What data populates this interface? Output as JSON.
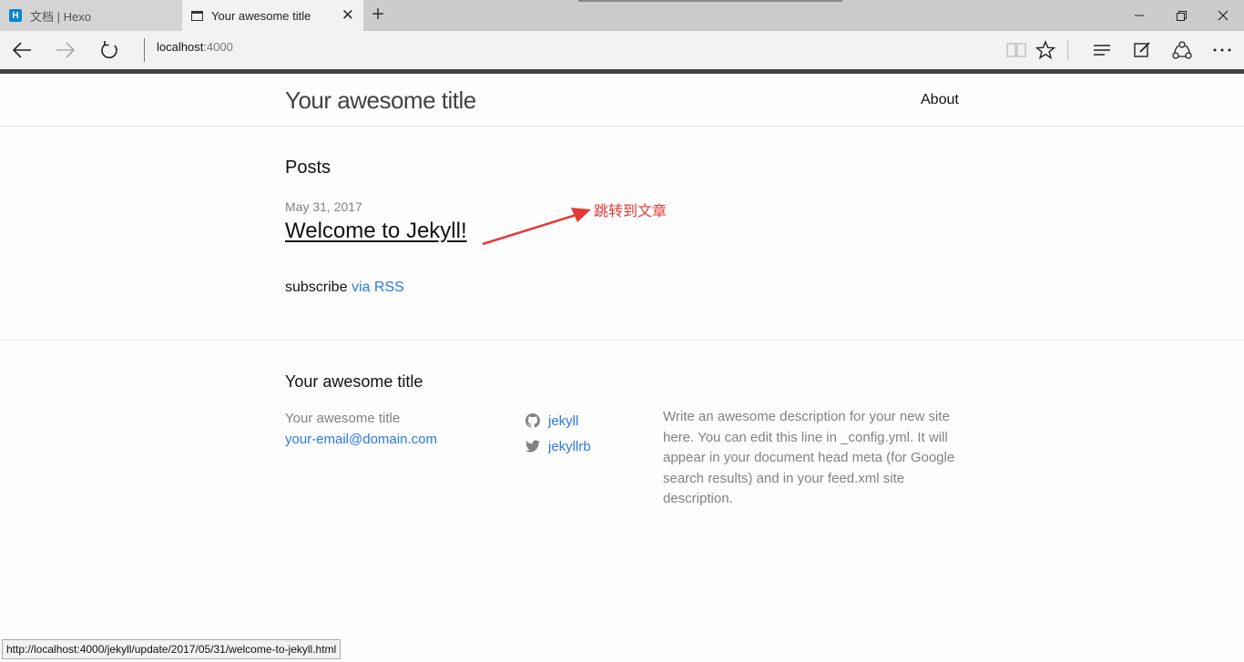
{
  "browser": {
    "tabs": [
      {
        "title": "文档 | Hexo",
        "favicon": "hexo-icon"
      },
      {
        "title": "Your awesome title",
        "favicon": "page-icon"
      }
    ],
    "new_tab_glyph": "+",
    "close_glyph": "✕",
    "address": {
      "host": "localhost",
      "port": ":4000"
    },
    "status_url": "http://localhost:4000/jekyll/update/2017/05/31/welcome-to-jekyll.html"
  },
  "site": {
    "title": "Your awesome title",
    "nav": {
      "about": "About"
    }
  },
  "posts": {
    "heading": "Posts",
    "items": [
      {
        "date": "May 31, 2017",
        "title": "Welcome to Jekyll!"
      }
    ],
    "subscribe_text": "subscribe",
    "rss_link": "via RSS"
  },
  "annotation": {
    "text": "跳转到文章",
    "color": "#e53935"
  },
  "footer": {
    "heading": "Your awesome title",
    "name": "Your awesome title",
    "email": "your-email@domain.com",
    "github": "jekyll",
    "twitter": "jekyllrb",
    "description": "Write an awesome description for your new site here. You can edit this line in _config.yml. It will appear in your document head meta (for Google search results) and in your feed.xml site description."
  },
  "colors": {
    "link": "#2a7ae2",
    "muted": "#828282",
    "chrome_border": "#424242"
  }
}
